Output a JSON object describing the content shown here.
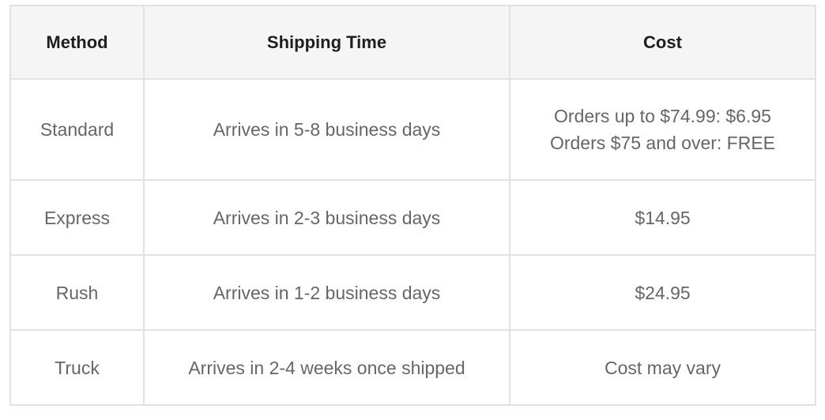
{
  "table": {
    "headers": {
      "method": "Method",
      "shipping_time": "Shipping Time",
      "cost": "Cost"
    },
    "rows": [
      {
        "method": "Standard",
        "shipping_time": "Arrives in 5-8 business days",
        "cost_lines": [
          "Orders up to $74.99: $6.95",
          "Orders $75 and over: FREE"
        ]
      },
      {
        "method": "Express",
        "shipping_time": "Arrives in 2-3 business days",
        "cost": "$14.95"
      },
      {
        "method": "Rush",
        "shipping_time": "Arrives in 1-2 business days",
        "cost": "$24.95"
      },
      {
        "method": "Truck",
        "shipping_time": "Arrives in 2-4 weeks once shipped",
        "cost": "Cost may vary"
      }
    ]
  },
  "colors": {
    "header_background": "#f5f5f5",
    "border": "#e2e2e2",
    "header_text": "#1e1e1e",
    "body_text": "#666666"
  }
}
